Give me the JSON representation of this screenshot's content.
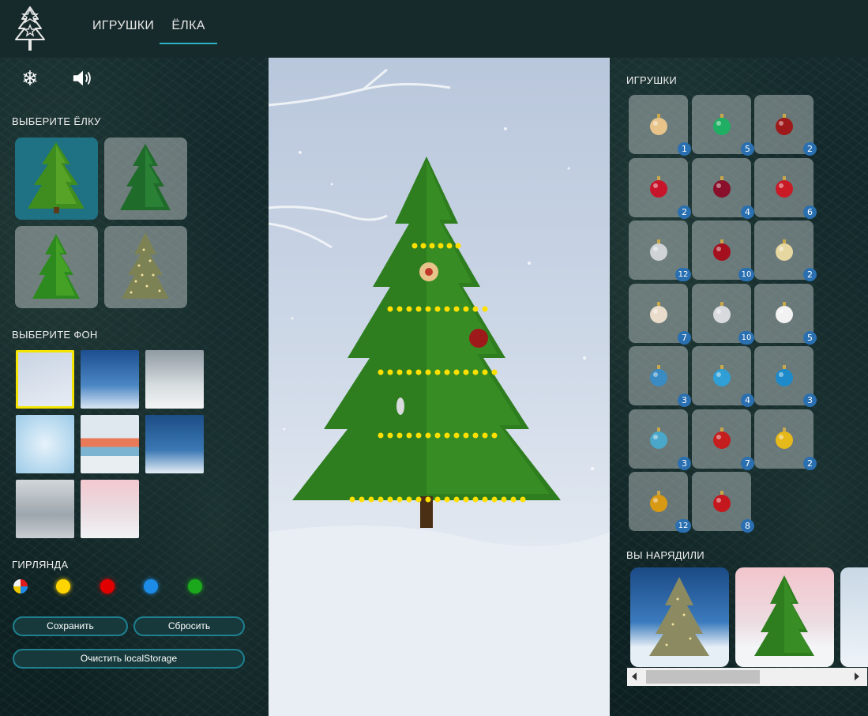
{
  "nav": {
    "toys": "ИГРУШКИ",
    "tree": "ЁЛКА"
  },
  "left": {
    "choose_tree": "ВЫБЕРИТЕ ЁЛКУ",
    "choose_bg": "ВЫБЕРИТЕ ФОН",
    "garland": "ГИРЛЯНДА",
    "buttons": {
      "save": "Сохранить",
      "reset": "Сбросить",
      "clear": "Очистить localStorage"
    },
    "garland_colors": [
      "multicolor",
      "#ffd400",
      "#e00000",
      "#1c8ce8",
      "#1ca81c"
    ]
  },
  "right": {
    "toys_title": "ИГРУШКИ",
    "dressed_title": "ВЫ НАРЯДИЛИ",
    "toys": [
      {
        "icon": "gold-star-ball",
        "color": "#e8c48a",
        "count": "1"
      },
      {
        "icon": "green-ball",
        "color": "#1fae62",
        "count": "5"
      },
      {
        "icon": "red-ball",
        "color": "#9e1a1a",
        "count": "2"
      },
      {
        "icon": "red-white-drop",
        "color": "#c8142a",
        "count": "2"
      },
      {
        "icon": "grapes",
        "color": "#8a0f2a",
        "count": "4"
      },
      {
        "icon": "red-ball",
        "color": "#c81b26",
        "count": "6"
      },
      {
        "icon": "silver-ring",
        "color": "#cfd3d6",
        "count": "12"
      },
      {
        "icon": "red-ball",
        "color": "#a5101e",
        "count": "10"
      },
      {
        "icon": "gold-bell",
        "color": "#e6d7a0",
        "count": "2"
      },
      {
        "icon": "pearl-ball",
        "color": "#e9dccb",
        "count": "7"
      },
      {
        "icon": "silver-icicle",
        "color": "#d8dade",
        "count": "10"
      },
      {
        "icon": "white-ball",
        "color": "#f2f2f2",
        "count": "5"
      },
      {
        "icon": "blue-ball",
        "color": "#3a8bc2",
        "count": "3"
      },
      {
        "icon": "blue-ball",
        "color": "#2f9fd6",
        "count": "4"
      },
      {
        "icon": "blue-bell",
        "color": "#1e8ac9",
        "count": "3"
      },
      {
        "icon": "blue-drop",
        "color": "#4aa7c9",
        "count": "3"
      },
      {
        "icon": "santa",
        "color": "#c41e1e",
        "count": "7"
      },
      {
        "icon": "gold-bow",
        "color": "#e6b91a",
        "count": "2"
      },
      {
        "icon": "gold-ball",
        "color": "#d89a15",
        "count": "12"
      },
      {
        "icon": "red-ball",
        "color": "#c4181e",
        "count": "8"
      }
    ]
  }
}
